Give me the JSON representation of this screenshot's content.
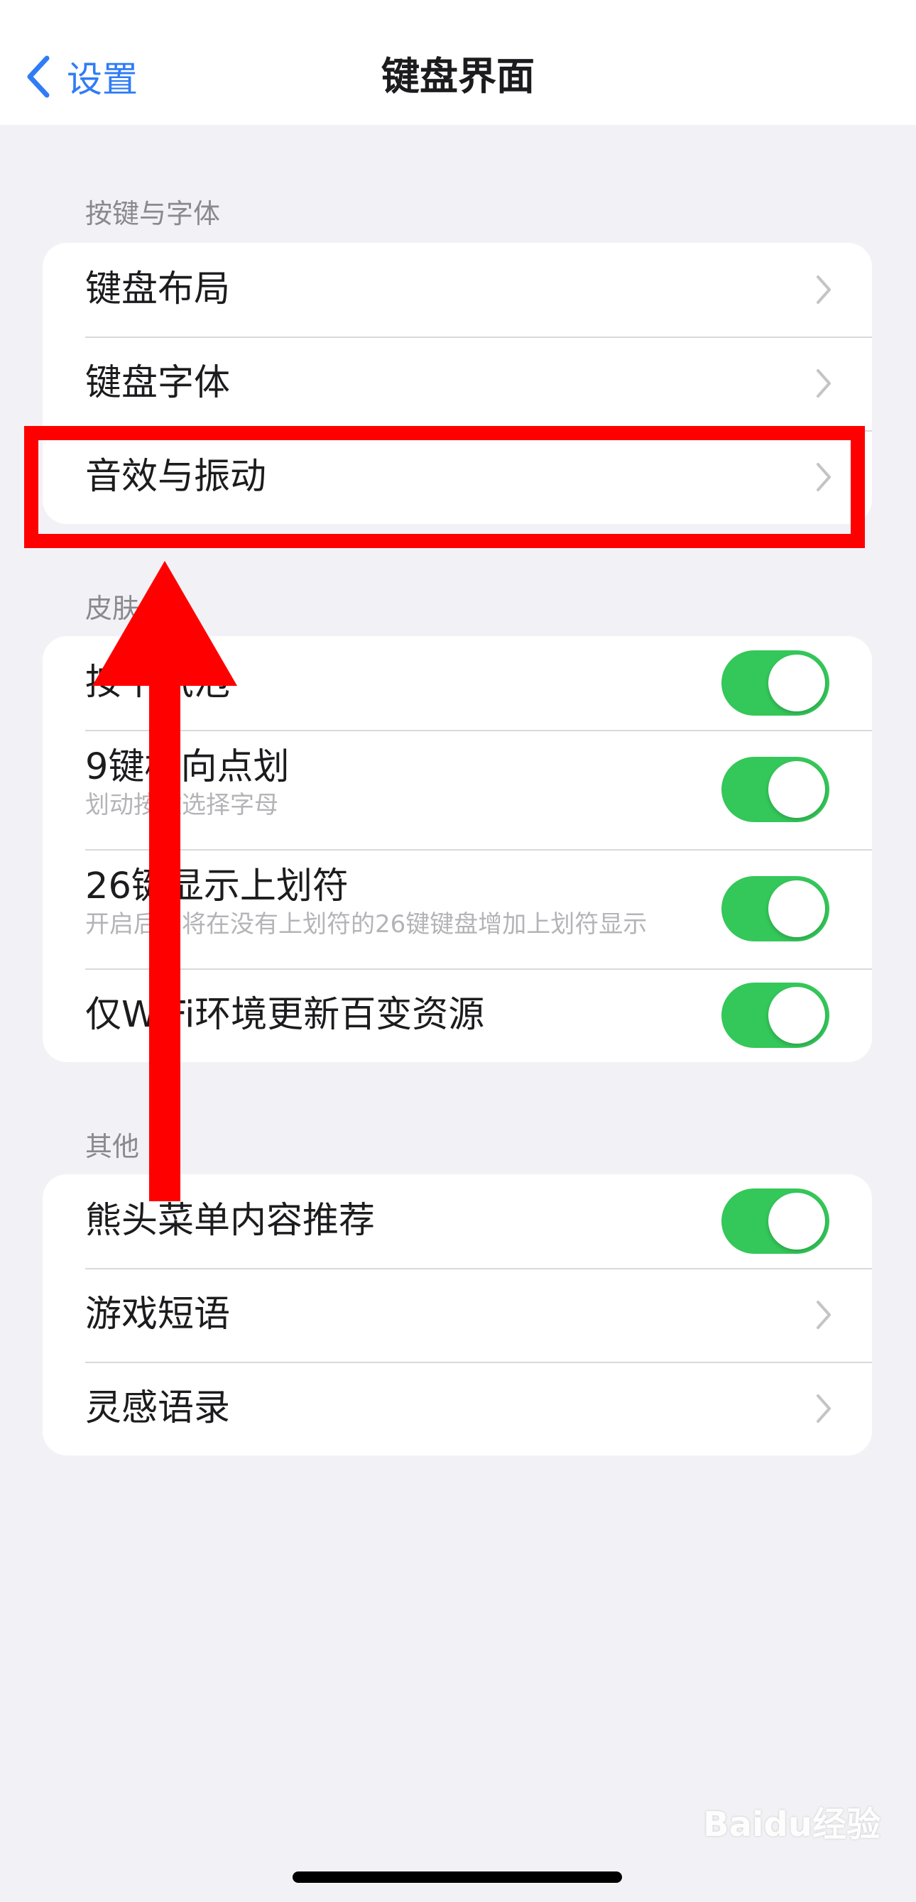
{
  "navbar": {
    "back_label": "设置",
    "title": "键盘界面"
  },
  "sections": {
    "keys_fonts": {
      "header": "按键与字体",
      "items": [
        {
          "label": "键盘布局"
        },
        {
          "label": "键盘字体"
        },
        {
          "label": "音效与振动"
        }
      ]
    },
    "skin": {
      "header": "皮肤",
      "items": [
        {
          "label": "按下气泡",
          "enabled": true
        },
        {
          "label": "9键横向点划",
          "sub": "划动按键选择字母",
          "enabled": true
        },
        {
          "label": "26键显示上划符",
          "sub": "开启后，将在没有上划符的26键键盘增加上划符显示",
          "enabled": true
        },
        {
          "label": "仅WiFi环境更新百变资源",
          "enabled": true
        }
      ]
    },
    "other": {
      "header": "其他",
      "items": [
        {
          "label": "熊头菜单内容推荐",
          "enabled": true
        },
        {
          "label": "游戏短语"
        },
        {
          "label": "灵感语录"
        }
      ]
    }
  },
  "annotation": {
    "highlight_color": "#ff0000",
    "highlighted_item": "音效与振动"
  },
  "colors": {
    "accent": "#2f7cf6",
    "toggle_on": "#34c759",
    "background": "#f2f2f6"
  },
  "watermark": "Baidu经验",
  "icons": [
    "chevron-left-icon",
    "chevron-right-icon"
  ]
}
